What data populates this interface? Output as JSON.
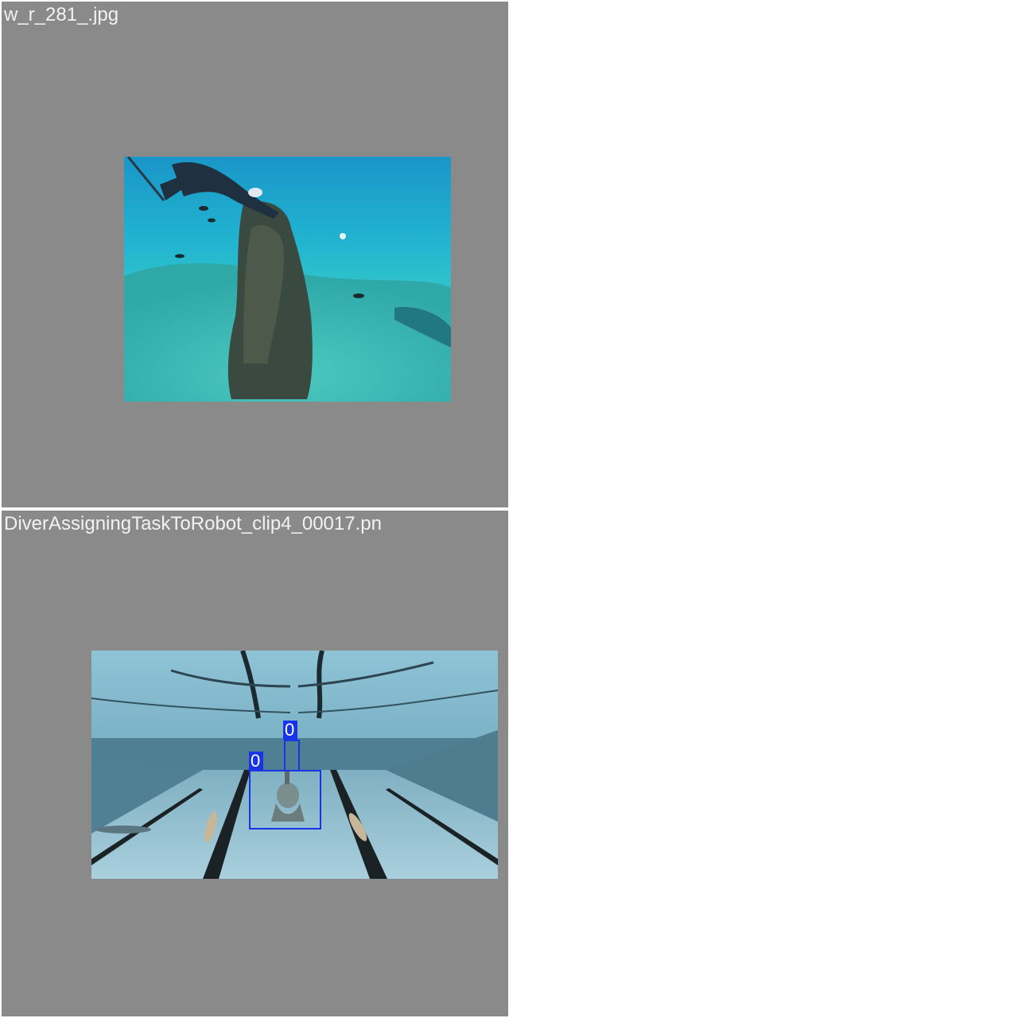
{
  "tiles": [
    {
      "filename": "w_r_281_.jpg",
      "scene": "underwater-statue"
    },
    {
      "filename": "DiverAssigningTaskToRobot_clip4_00017.pn",
      "scene": "swimming-pool",
      "detections": [
        {
          "class_label": "0"
        },
        {
          "class_label": "0"
        }
      ]
    }
  ],
  "colors": {
    "tile_background": "#8a8a8a",
    "bbox": "#1834e6",
    "label_text": "#ffffff"
  }
}
